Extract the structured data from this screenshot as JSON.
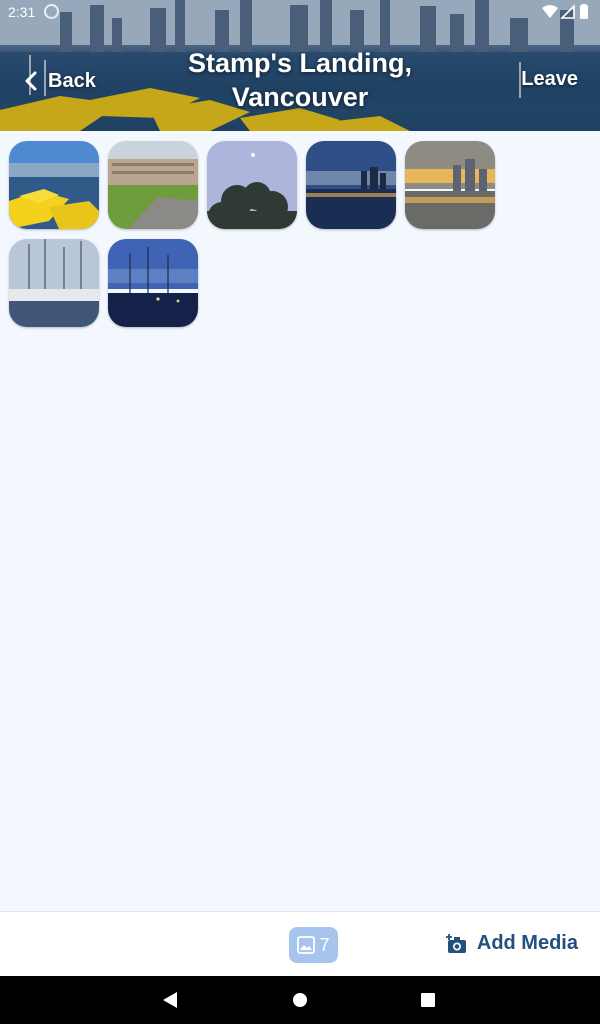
{
  "status_bar": {
    "time": "2:31"
  },
  "header": {
    "back_label": "Back",
    "title": "Stamp's Landing, Vancouver",
    "leave_label": "Leave"
  },
  "gallery": {
    "items": [
      {
        "description_icon": "photo-yellow-umbrellas-harbor"
      },
      {
        "description_icon": "photo-apartment-lawn"
      },
      {
        "description_icon": "photo-tree-dusk-sky"
      },
      {
        "description_icon": "photo-skyline-reflection-night"
      },
      {
        "description_icon": "photo-sunset-towers-water"
      },
      {
        "description_icon": "photo-marina-sailboats"
      },
      {
        "description_icon": "photo-marina-blue-hour"
      }
    ]
  },
  "bottom_bar": {
    "media_count": "7",
    "add_media_label": "Add Media"
  },
  "colors": {
    "accent": "#23507f",
    "badge": "#a7c5ec",
    "background": "#f3f7fe"
  }
}
